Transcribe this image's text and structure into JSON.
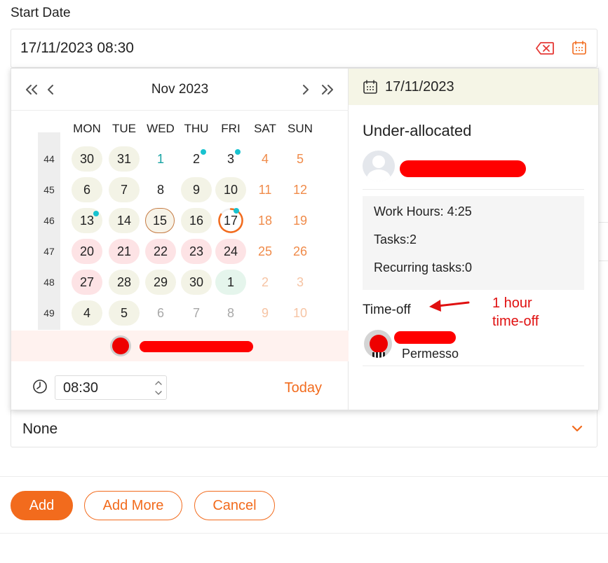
{
  "form": {
    "start_date_label": "Start Date",
    "start_date_value": "17/11/2023 08:30",
    "select_value": "None"
  },
  "calendar": {
    "month_title": "Nov 2023",
    "weekdays": [
      "MON",
      "TUE",
      "WED",
      "THU",
      "FRI",
      "SAT",
      "SUN"
    ],
    "week_numbers": [
      "44",
      "45",
      "46",
      "47",
      "48",
      "49"
    ],
    "weeks": [
      [
        "30",
        "31",
        "1",
        "2",
        "3",
        "4",
        "5"
      ],
      [
        "6",
        "7",
        "8",
        "9",
        "10",
        "11",
        "12"
      ],
      [
        "13",
        "14",
        "15",
        "16",
        "17",
        "18",
        "19"
      ],
      [
        "20",
        "21",
        "22",
        "23",
        "24",
        "25",
        "26"
      ],
      [
        "27",
        "28",
        "29",
        "30",
        "1",
        "2",
        "3"
      ],
      [
        "4",
        "5",
        "6",
        "7",
        "8",
        "9",
        "10"
      ]
    ],
    "time_value": "08:30",
    "today_label": "Today"
  },
  "detail": {
    "date": "17/11/2023",
    "status": "Under-allocated",
    "work_hours": "Work Hours: 4:25",
    "tasks": "Tasks:2",
    "recurring": "Recurring tasks:0",
    "time_off_label": "Time-off",
    "time_off_name": "Permesso",
    "annotation_line1": "1 hour",
    "annotation_line2": "time-off"
  },
  "footer": {
    "add_label": "Add",
    "add_more_label": "Add More",
    "cancel_label": "Cancel"
  },
  "colors": {
    "accent": "#f26b1d",
    "teal_dot": "#18c2cf",
    "annotation": "#e01010"
  }
}
